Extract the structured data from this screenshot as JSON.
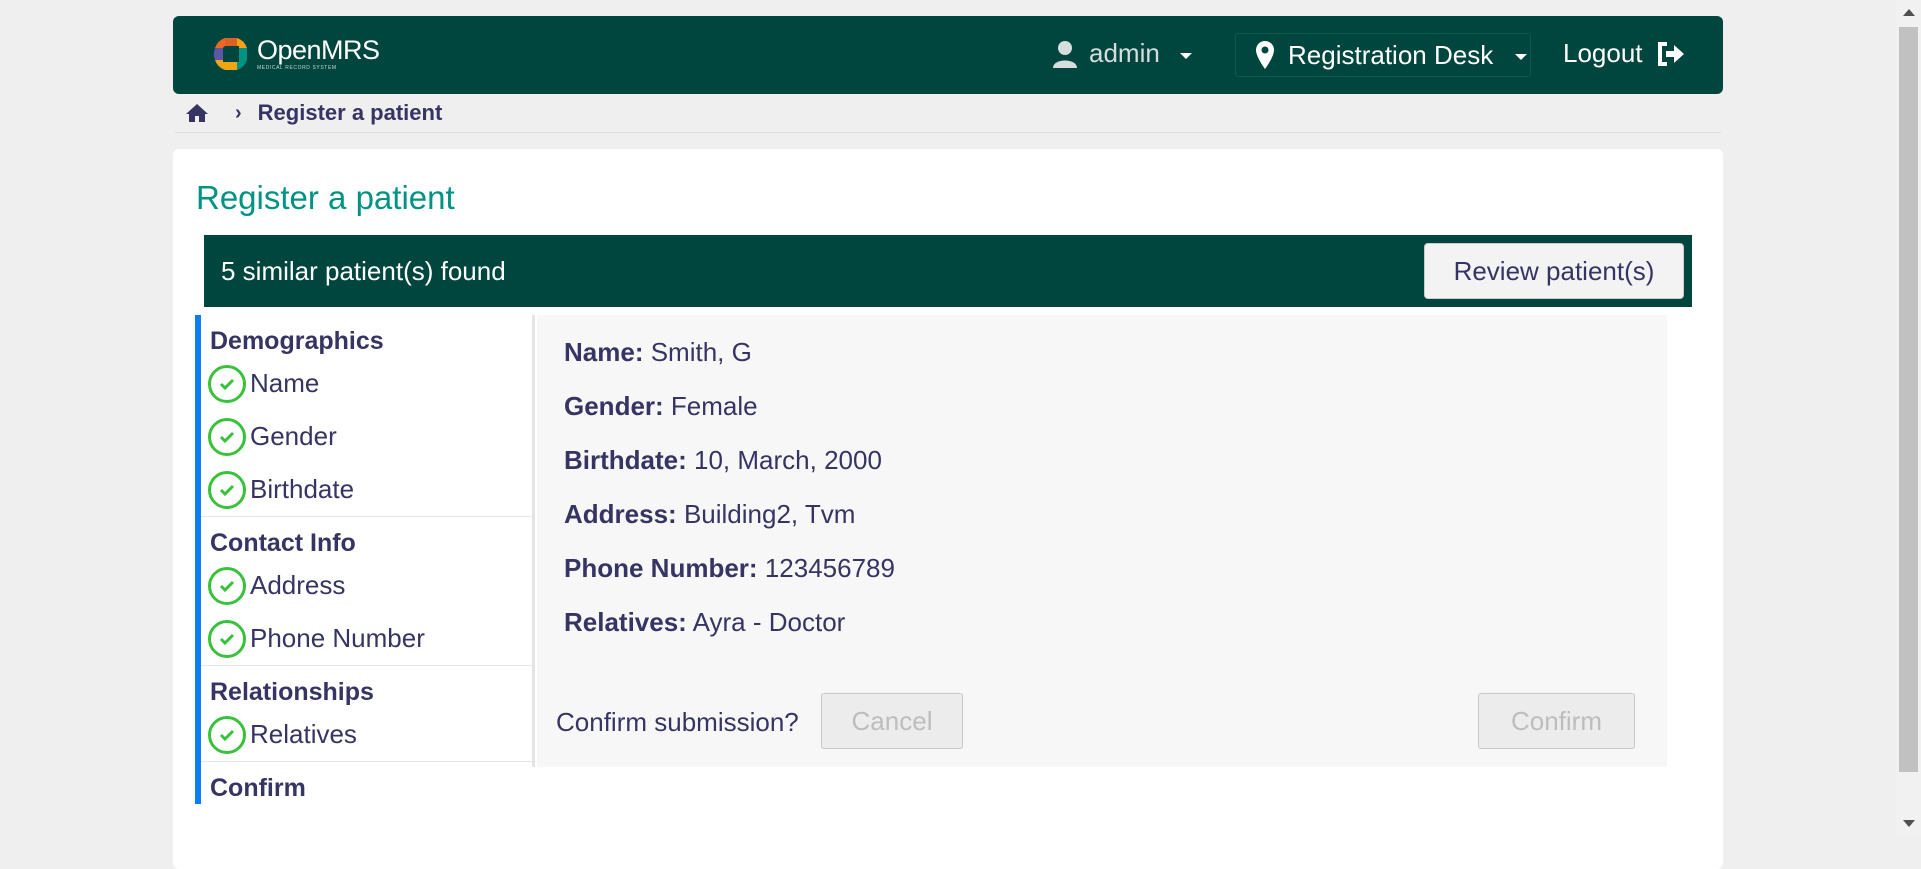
{
  "header": {
    "logo_name": "OpenMRS",
    "logo_subtitle": "MEDICAL RECORD SYSTEM",
    "user": "admin",
    "location": "Registration Desk",
    "logout": "Logout"
  },
  "breadcrumb": {
    "current": "Register a patient"
  },
  "page": {
    "title": "Register a patient"
  },
  "banner": {
    "text": "5 similar patient(s) found",
    "review_button": "Review patient(s)"
  },
  "sidebar": {
    "sections": [
      {
        "title": "Demographics",
        "items": [
          "Name",
          "Gender",
          "Birthdate"
        ]
      },
      {
        "title": "Contact Info",
        "items": [
          "Address",
          "Phone Number"
        ]
      },
      {
        "title": "Relationships",
        "items": [
          "Relatives"
        ]
      },
      {
        "title": "Confirm",
        "items": []
      }
    ]
  },
  "summary": {
    "name_label": "Name:",
    "name_value": "Smith, G",
    "gender_label": "Gender:",
    "gender_value": "Female",
    "birthdate_label": "Birthdate:",
    "birthdate_value": "10, March, 2000",
    "address_label": "Address:",
    "address_value": "Building2, Tvm",
    "phone_label": "Phone Number:",
    "phone_value": "123456789",
    "relatives_label": "Relatives:",
    "relatives_value": "Ayra - Doctor",
    "confirm_question": "Confirm submission?",
    "cancel_button": "Cancel",
    "confirm_button": "Confirm"
  },
  "colors": {
    "header_bg": "#00463f",
    "title_teal": "#009384",
    "accent_blue": "#0c7ef2",
    "check_green": "#37c23a",
    "text": "#363463"
  }
}
